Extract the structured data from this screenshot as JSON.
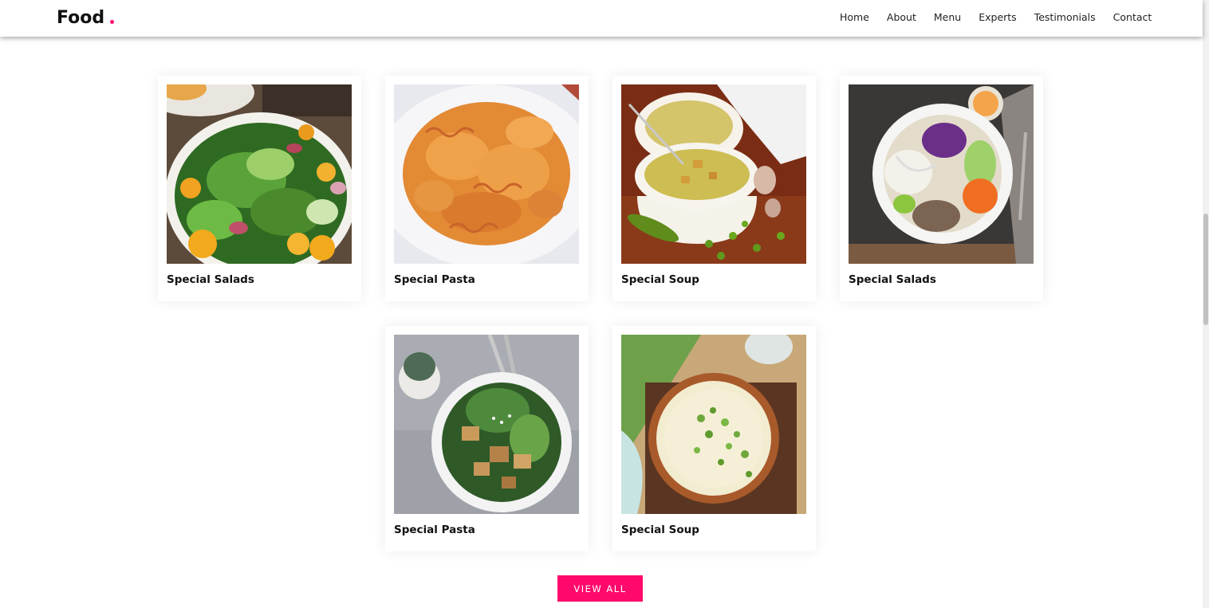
{
  "header": {
    "brand": "Food",
    "brand_dot_color": "#ff0a6c",
    "nav": [
      "Home",
      "About",
      "Menu",
      "Experts",
      "Testimonials",
      "Contact"
    ]
  },
  "menu": {
    "cards": [
      {
        "title": "Special Salads",
        "image": "salad-plate-image"
      },
      {
        "title": "Special Pasta",
        "image": "fusilli-pasta-image"
      },
      {
        "title": "Special Soup",
        "image": "cream-soup-image"
      },
      {
        "title": "Special Salads",
        "image": "noodle-salad-bowl-image"
      },
      {
        "title": "Special Pasta",
        "image": "tofu-greens-bowl-image"
      },
      {
        "title": "Special Soup",
        "image": "miso-soup-image"
      }
    ],
    "view_all_label": "VIEW ALL"
  },
  "colors": {
    "accent": "#ff0a6c"
  }
}
